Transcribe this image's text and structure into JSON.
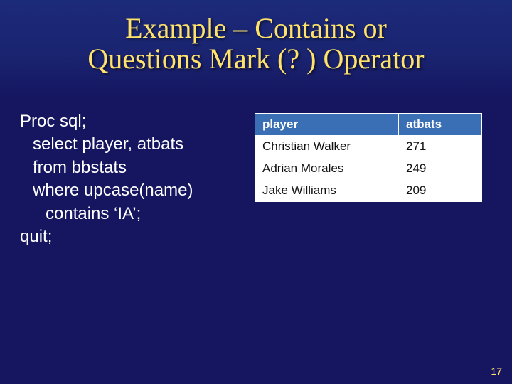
{
  "title_line1": "Example – Contains or",
  "title_line2": "Questions Mark (? ) Operator",
  "code": {
    "l1": "Proc sql;",
    "l2": "select player, atbats",
    "l3": "from bbstats",
    "l4": "where upcase(name)",
    "l5": "contains ‘IA’;",
    "l6": "quit;"
  },
  "table": {
    "headers": {
      "c1": "player",
      "c2": "atbats"
    },
    "rows": [
      {
        "c1": "Christian Walker",
        "c2": "271"
      },
      {
        "c1": "Adrian Morales",
        "c2": "249"
      },
      {
        "c1": "Jake Williams",
        "c2": "209"
      }
    ]
  },
  "page_number": "17"
}
